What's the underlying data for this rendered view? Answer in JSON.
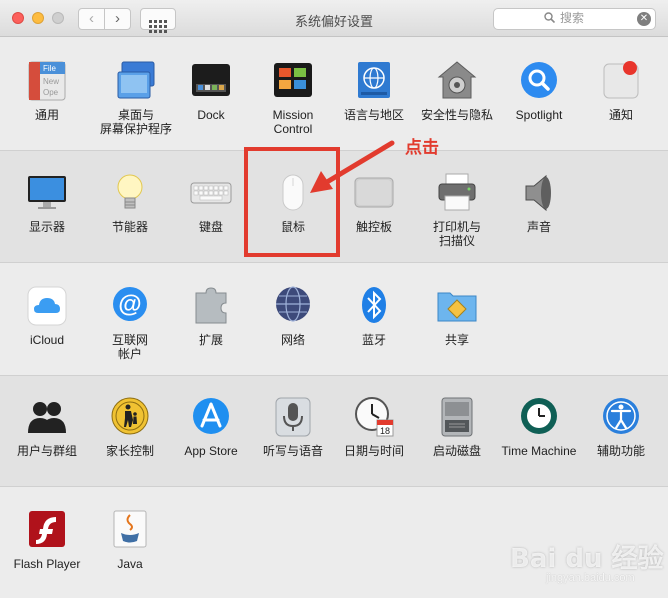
{
  "window": {
    "title": "系统偏好设置"
  },
  "toolbar": {
    "back_glyph": "‹",
    "forward_glyph": "›"
  },
  "search": {
    "placeholder": "搜索",
    "icon": "magnifier-icon",
    "clear_glyph": "✕"
  },
  "rows": [
    {
      "panes": [
        {
          "label": "通用",
          "icon": "general-icon"
        },
        {
          "label": "桌面与\n屏幕保护程序",
          "icon": "desktop-screensaver-icon"
        },
        {
          "label": "Dock",
          "icon": "dock-icon"
        },
        {
          "label": "Mission\nControl",
          "icon": "mission-control-icon"
        },
        {
          "label": "语言与地区",
          "icon": "language-region-icon"
        },
        {
          "label": "安全性与隐私",
          "icon": "security-privacy-icon"
        },
        {
          "label": "Spotlight",
          "icon": "spotlight-icon"
        },
        {
          "label": "通知",
          "icon": "notifications-icon"
        }
      ]
    },
    {
      "panes": [
        {
          "label": "显示器",
          "icon": "displays-icon"
        },
        {
          "label": "节能器",
          "icon": "energy-saver-icon"
        },
        {
          "label": "键盘",
          "icon": "keyboard-icon"
        },
        {
          "label": "鼠标",
          "icon": "mouse-icon"
        },
        {
          "label": "触控板",
          "icon": "trackpad-icon"
        },
        {
          "label": "打印机与\n扫描仪",
          "icon": "printers-scanners-icon"
        },
        {
          "label": "声音",
          "icon": "sound-icon"
        }
      ]
    },
    {
      "panes": [
        {
          "label": "iCloud",
          "icon": "icloud-icon"
        },
        {
          "label": "互联网\n帐户",
          "icon": "internet-accounts-icon"
        },
        {
          "label": "扩展",
          "icon": "extensions-icon"
        },
        {
          "label": "网络",
          "icon": "network-icon"
        },
        {
          "label": "蓝牙",
          "icon": "bluetooth-icon"
        },
        {
          "label": "共享",
          "icon": "sharing-icon"
        }
      ]
    },
    {
      "panes": [
        {
          "label": "用户与群组",
          "icon": "users-groups-icon"
        },
        {
          "label": "家长控制",
          "icon": "parental-controls-icon"
        },
        {
          "label": "App Store",
          "icon": "app-store-icon"
        },
        {
          "label": "听写与语音",
          "icon": "dictation-speech-icon"
        },
        {
          "label": "日期与时间",
          "icon": "date-time-icon"
        },
        {
          "label": "启动磁盘",
          "icon": "startup-disk-icon"
        },
        {
          "label": "Time Machine",
          "icon": "time-machine-icon"
        },
        {
          "label": "辅助功能",
          "icon": "accessibility-icon"
        }
      ]
    },
    {
      "panes": [
        {
          "label": "Flash Player",
          "icon": "flash-player-icon"
        },
        {
          "label": "Java",
          "icon": "java-icon"
        }
      ]
    }
  ],
  "general_icon_text": [
    "File",
    "New",
    "Ope"
  ],
  "date_icon_day": "18",
  "annotation": {
    "text": "点击",
    "color": "#e23b2e"
  },
  "watermark": {
    "logo": "Bai du 经验",
    "url": "jingyan.baidu.com"
  },
  "colors": {
    "accent": "#1a82fb",
    "annotation_red": "#e23b2e"
  }
}
